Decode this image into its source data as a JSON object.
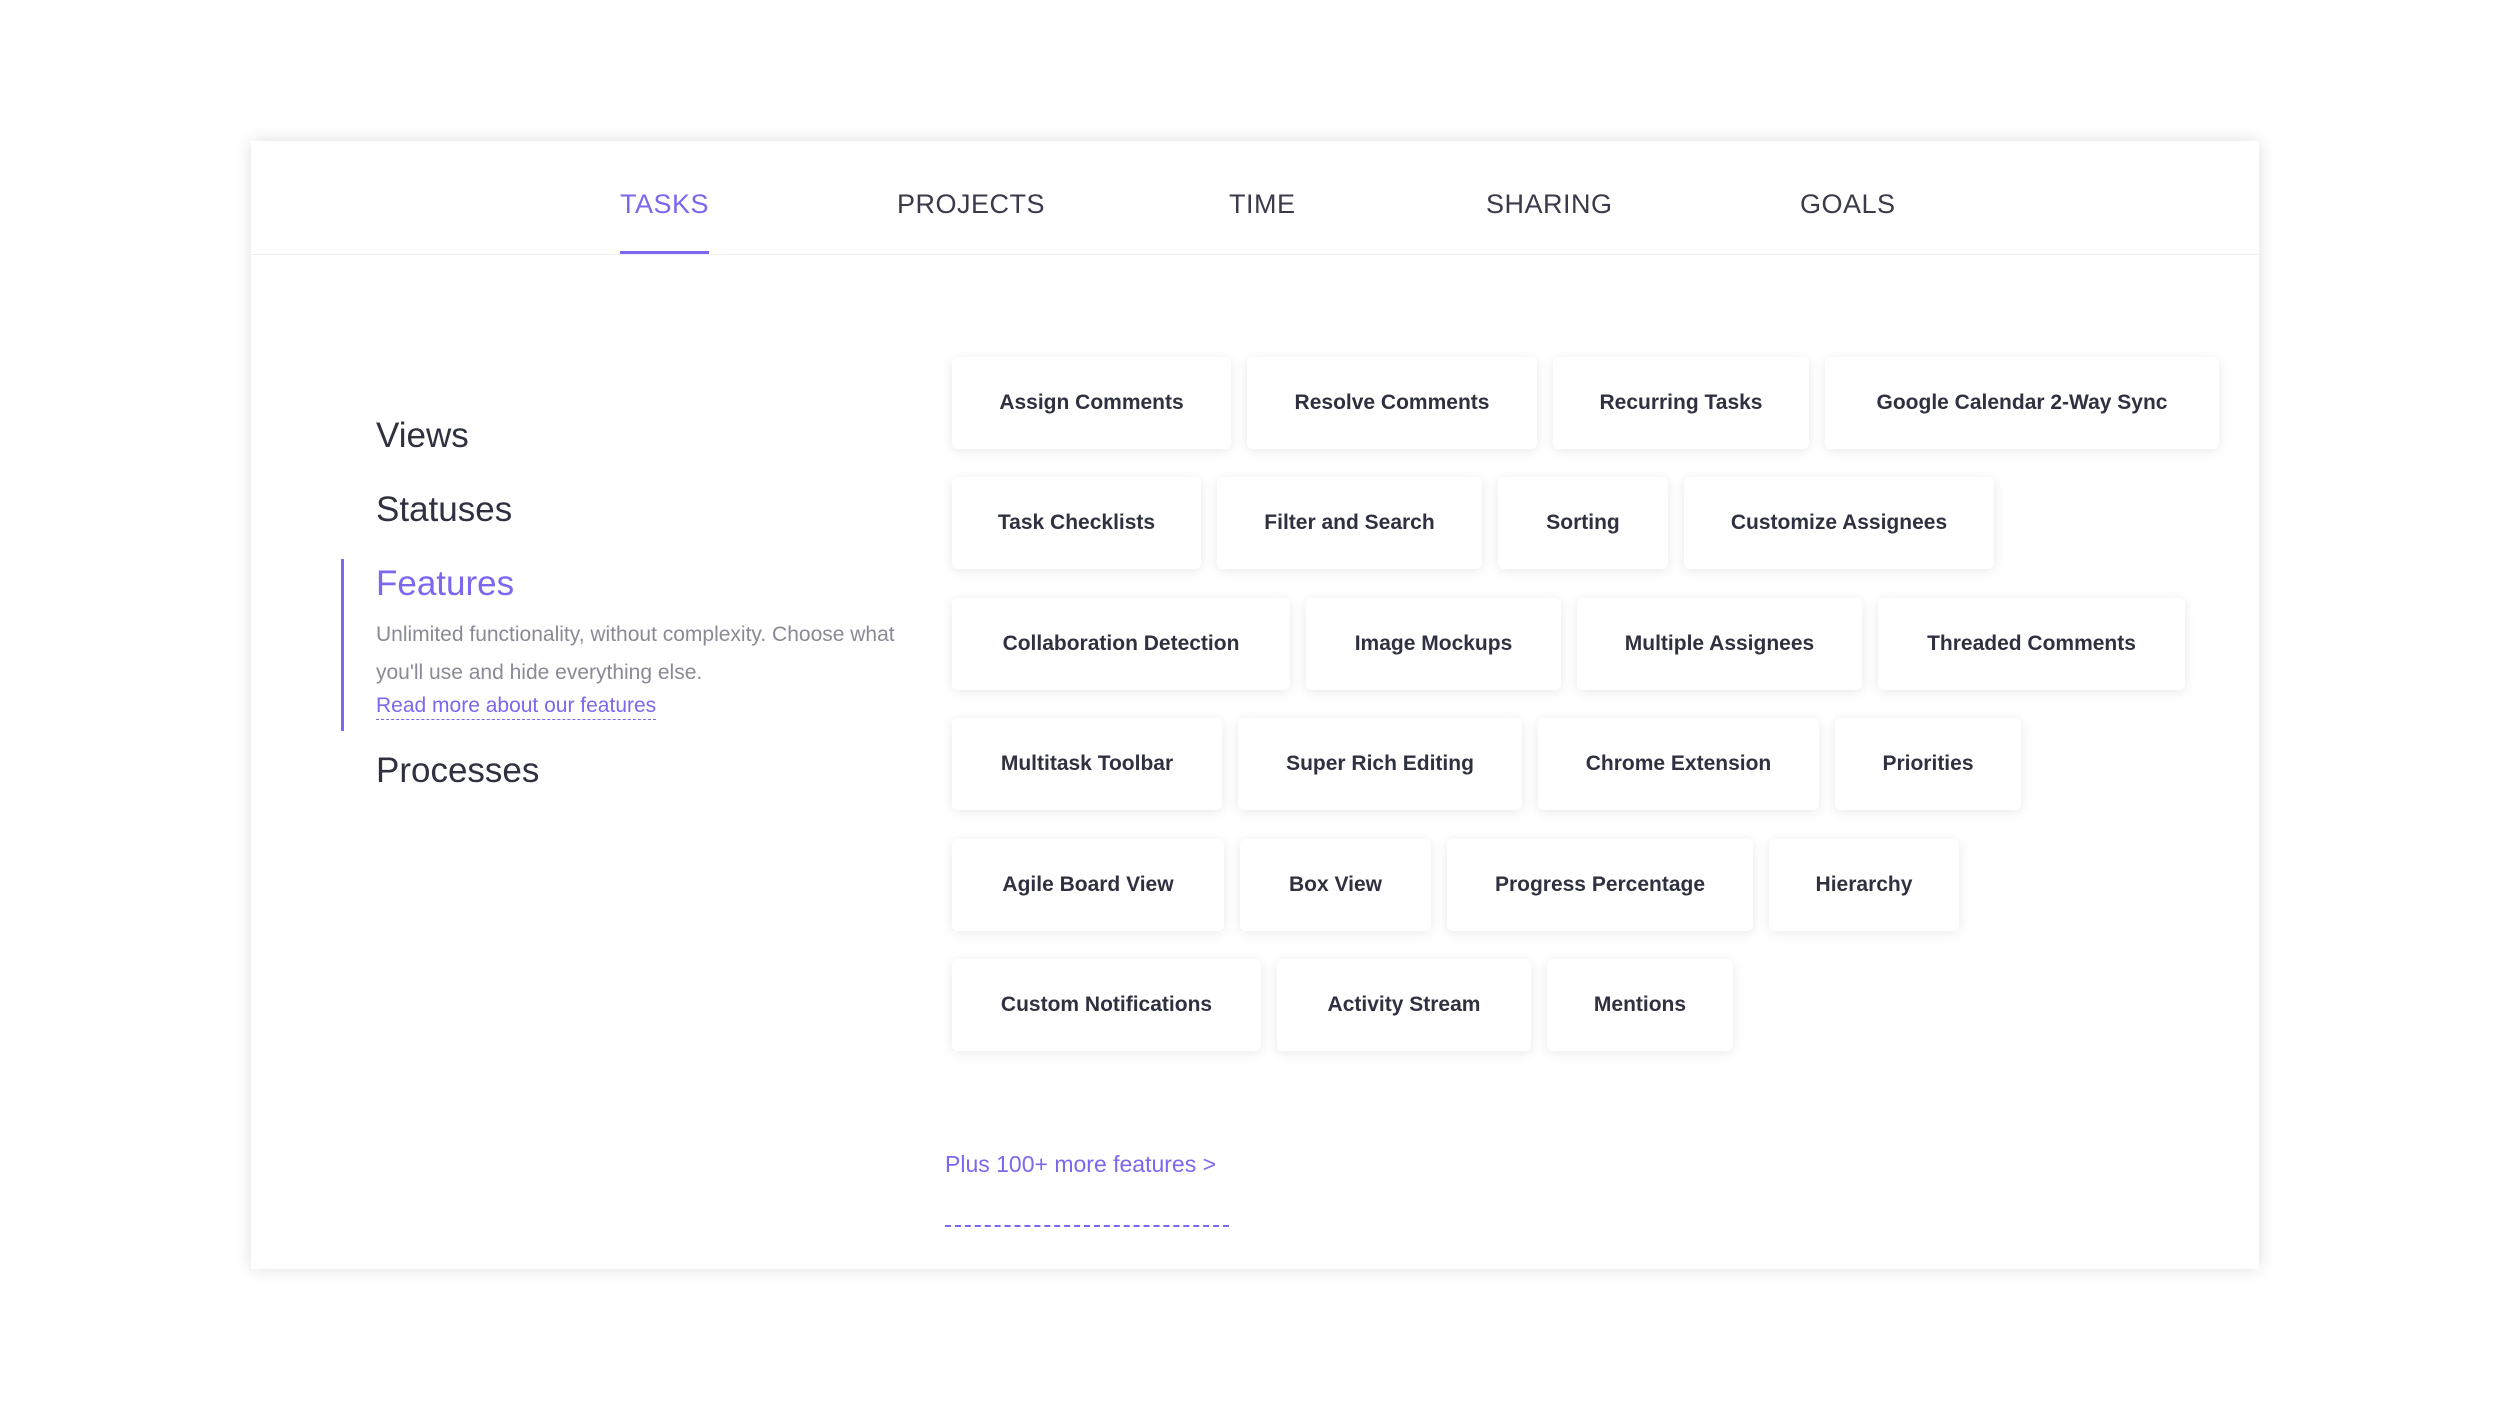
{
  "tabs": [
    "TASKS",
    "PROJECTS",
    "TIME",
    "SHARING",
    "GOALS"
  ],
  "active_tab": "TASKS",
  "sidebar": {
    "views": "Views",
    "statuses": "Statuses",
    "features": "Features",
    "features_description": "Unlimited functionality, without complexity. Choose what you'll use and hide everything else.",
    "features_link": "Read more about our features",
    "processes": "Processes"
  },
  "features": [
    [
      "Assign Comments",
      "Resolve Comments",
      "Recurring Tasks",
      "Google Calendar 2-Way Sync"
    ],
    [
      "Task Checklists",
      "Filter and Search",
      "Sorting",
      "Customize Assignees"
    ],
    [
      "Collaboration Detection",
      "Image Mockups",
      "Multiple Assignees",
      "Threaded Comments"
    ],
    [
      "Multitask Toolbar",
      "Super Rich Editing",
      "Chrome Extension",
      "Priorities"
    ],
    [
      "Agile Board View",
      "Box View",
      "Progress Percentage",
      "Hierarchy"
    ],
    [
      "Custom Notifications",
      "Activity Stream",
      "Mentions"
    ]
  ],
  "more_features": "Plus 100+ more features >",
  "colors": {
    "accent": "#7b68ee",
    "text": "#2f3140",
    "muted": "#8a8a96"
  }
}
